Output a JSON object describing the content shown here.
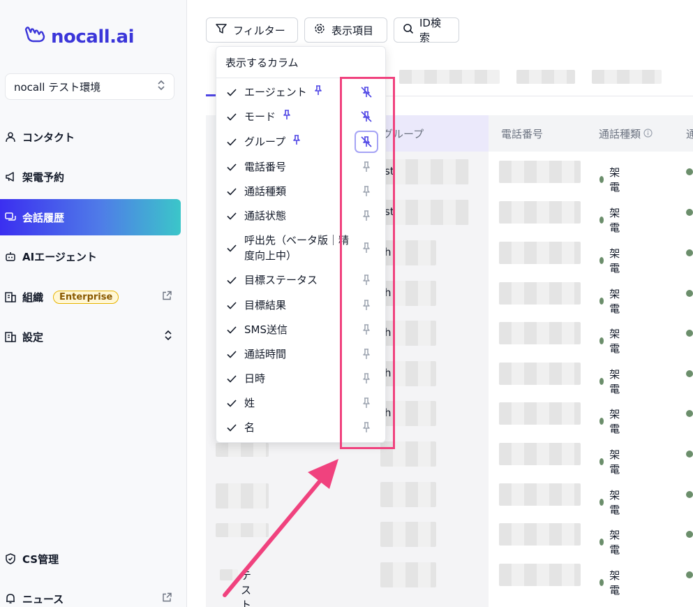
{
  "brand": {
    "name": "nocall.ai"
  },
  "env_select": {
    "value": "nocall テスト環境"
  },
  "sidebar": {
    "items": [
      {
        "label": "コンタクト",
        "icon": "user-icon"
      },
      {
        "label": "架電予約",
        "icon": "megaphone-icon"
      },
      {
        "label": "会話履歴",
        "icon": "chat-icon",
        "active": true
      },
      {
        "label": "AIエージェント",
        "icon": "bot-icon"
      },
      {
        "label": "組織",
        "icon": "building-icon",
        "badge": "Enterprise"
      },
      {
        "label": "設定",
        "icon": "building-icon"
      },
      {
        "label": "CS管理",
        "icon": "shield-icon"
      },
      {
        "label": "ニュース",
        "icon": "bell-icon"
      }
    ]
  },
  "toolbar": {
    "filter_label": "フィルター",
    "columns_label": "表示項目",
    "id_search_label": "ID検索"
  },
  "table": {
    "headers": [
      "グループ",
      "電話番号",
      "通話種類"
    ],
    "partial_header": "通",
    "partial_cells": [
      "st",
      "st",
      "h",
      "h",
      "h",
      "h",
      "h"
    ],
    "call_type": "架電",
    "row_count": 11,
    "last_row_text": "テスト"
  },
  "popover": {
    "title": "表示するカラム",
    "columns": [
      {
        "label": "エージェント",
        "pinned": true
      },
      {
        "label": "モード",
        "pinned": true
      },
      {
        "label": "グループ",
        "pinned": true
      },
      {
        "label": "電話番号",
        "pinned": false
      },
      {
        "label": "通話種類",
        "pinned": false
      },
      {
        "label": "通話状態",
        "pinned": false
      },
      {
        "label": "呼出先（ベータ版｜精度向上中）",
        "pinned": false
      },
      {
        "label": "目標ステータス",
        "pinned": false
      },
      {
        "label": "目標結果",
        "pinned": false
      },
      {
        "label": "SMS送信",
        "pinned": false
      },
      {
        "label": "通話時間",
        "pinned": false
      },
      {
        "label": "日時",
        "pinned": false
      },
      {
        "label": "姓",
        "pinned": false
      },
      {
        "label": "名",
        "pinned": false
      }
    ]
  },
  "colors": {
    "brand": "#3b36d9",
    "pin_active": "#4f46e5",
    "annotation": "#f0427e",
    "status_dot": "#6b8e6b"
  }
}
